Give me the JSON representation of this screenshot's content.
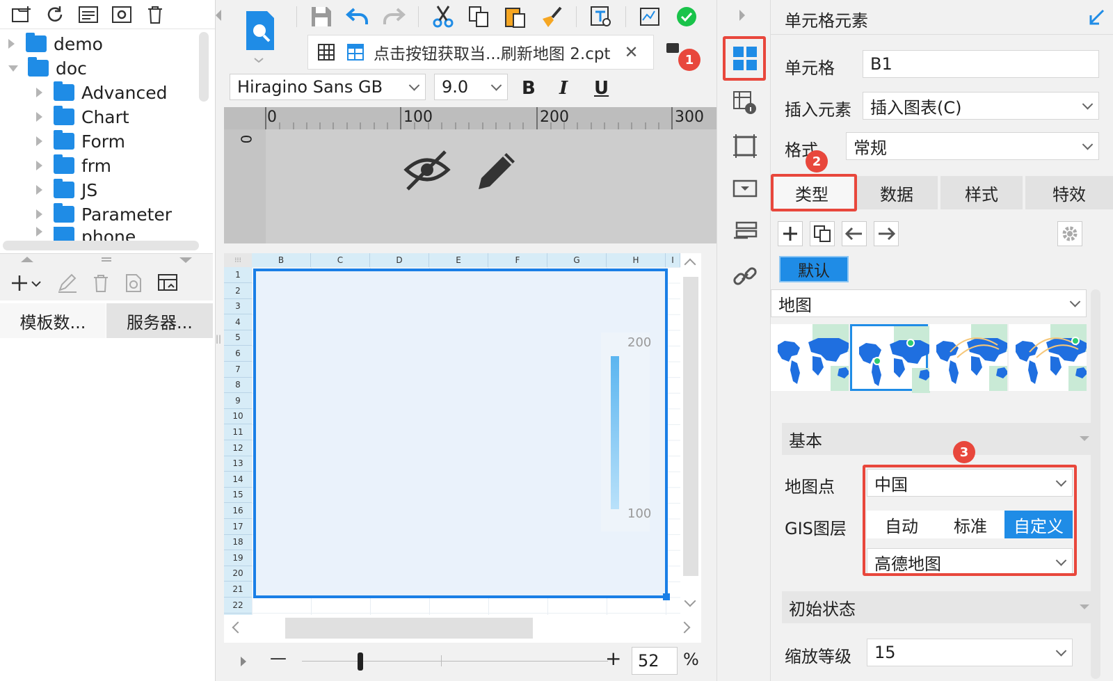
{
  "file_tree": {
    "items": [
      {
        "label": "demo",
        "level": 0,
        "expanded": false
      },
      {
        "label": "doc",
        "level": 0,
        "expanded": true
      },
      {
        "label": "Advanced",
        "level": 1
      },
      {
        "label": "Chart",
        "level": 1
      },
      {
        "label": "Form",
        "level": 1
      },
      {
        "label": "frm",
        "level": 1
      },
      {
        "label": "JS",
        "level": 1
      },
      {
        "label": "Parameter",
        "level": 1
      },
      {
        "label": "phone",
        "level": 1
      }
    ]
  },
  "dataset_tabs": {
    "template": "模板数...",
    "server": "服务器..."
  },
  "editor": {
    "tab_title": "点击按钮获取当...刷新地图 2.cpt",
    "font_family": "Hiragino Sans GB",
    "font_size": "9.0",
    "bold": "B",
    "italic": "I",
    "underline": "U",
    "ruler": [
      "0",
      "100",
      "200",
      "300"
    ],
    "ruler_vertical": "0",
    "columns": [
      "B",
      "C",
      "D",
      "E",
      "F",
      "G",
      "H",
      "I"
    ],
    "rows": [
      "1",
      "2",
      "3",
      "4",
      "5",
      "6",
      "7",
      "8",
      "9",
      "10",
      "11",
      "12",
      "13",
      "14",
      "15",
      "16",
      "17",
      "18",
      "19",
      "20",
      "21",
      "22"
    ],
    "legend_top": "200",
    "legend_bottom": "100",
    "zoom_value": "52",
    "zoom_unit": "%",
    "zoom_minus": "—",
    "zoom_plus": "+"
  },
  "badges": [
    "1",
    "2",
    "3"
  ],
  "panel": {
    "title": "单元格元素",
    "cell_label": "单元格",
    "cell_value": "B1",
    "insert_label": "插入元素",
    "insert_value": "插入图表(C)",
    "format_label": "格式",
    "format_value": "常规",
    "tabs": [
      "类型",
      "数据",
      "样式",
      "特效"
    ],
    "default_label": "默认",
    "chart_type": "地图",
    "basic_section": "基本",
    "map_point_label": "地图点",
    "map_point_value": "中国",
    "gis_label": "GIS图层",
    "gis_options": [
      "自动",
      "标准",
      "自定义"
    ],
    "gis_selected": "自定义",
    "gis_provider": "高德地图",
    "initial_section": "初始状态",
    "zoom_level_label": "缩放等级",
    "zoom_level_value": "15"
  },
  "colors": {
    "accent": "#1f8ce6",
    "highlight": "#e8473c",
    "selection": "#1a7fe6"
  }
}
